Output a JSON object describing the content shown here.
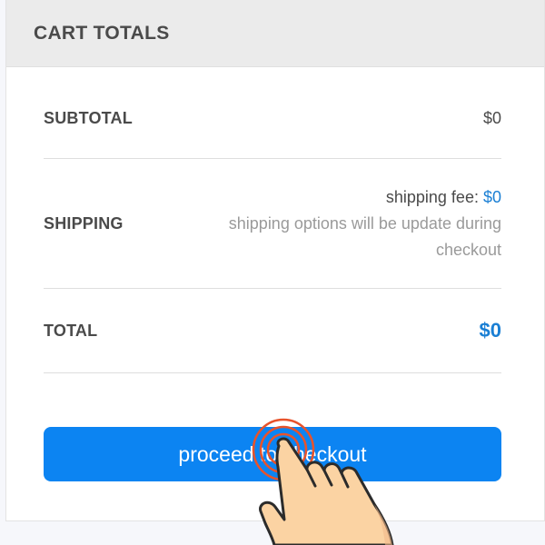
{
  "cart": {
    "title": "CART TOTALS",
    "subtotal_label": "SUBTOTAL",
    "subtotal_value": "$0",
    "shipping_label": "SHIPPING",
    "shipping_fee_label": "shipping fee:",
    "shipping_fee_value": "$0",
    "shipping_note": "shipping options will be update during checkout",
    "total_label": "TOTAL",
    "total_value": "$0",
    "checkout_label": "proceed to checkout"
  },
  "icons": {
    "pointer": "hand-pointer-icon",
    "tap": "tap-ripple-icon"
  },
  "colors": {
    "accent": "#0c84f2",
    "price": "#1a7fd4",
    "header_bg": "#ebebeb",
    "tap_ring": "#e8532b"
  }
}
